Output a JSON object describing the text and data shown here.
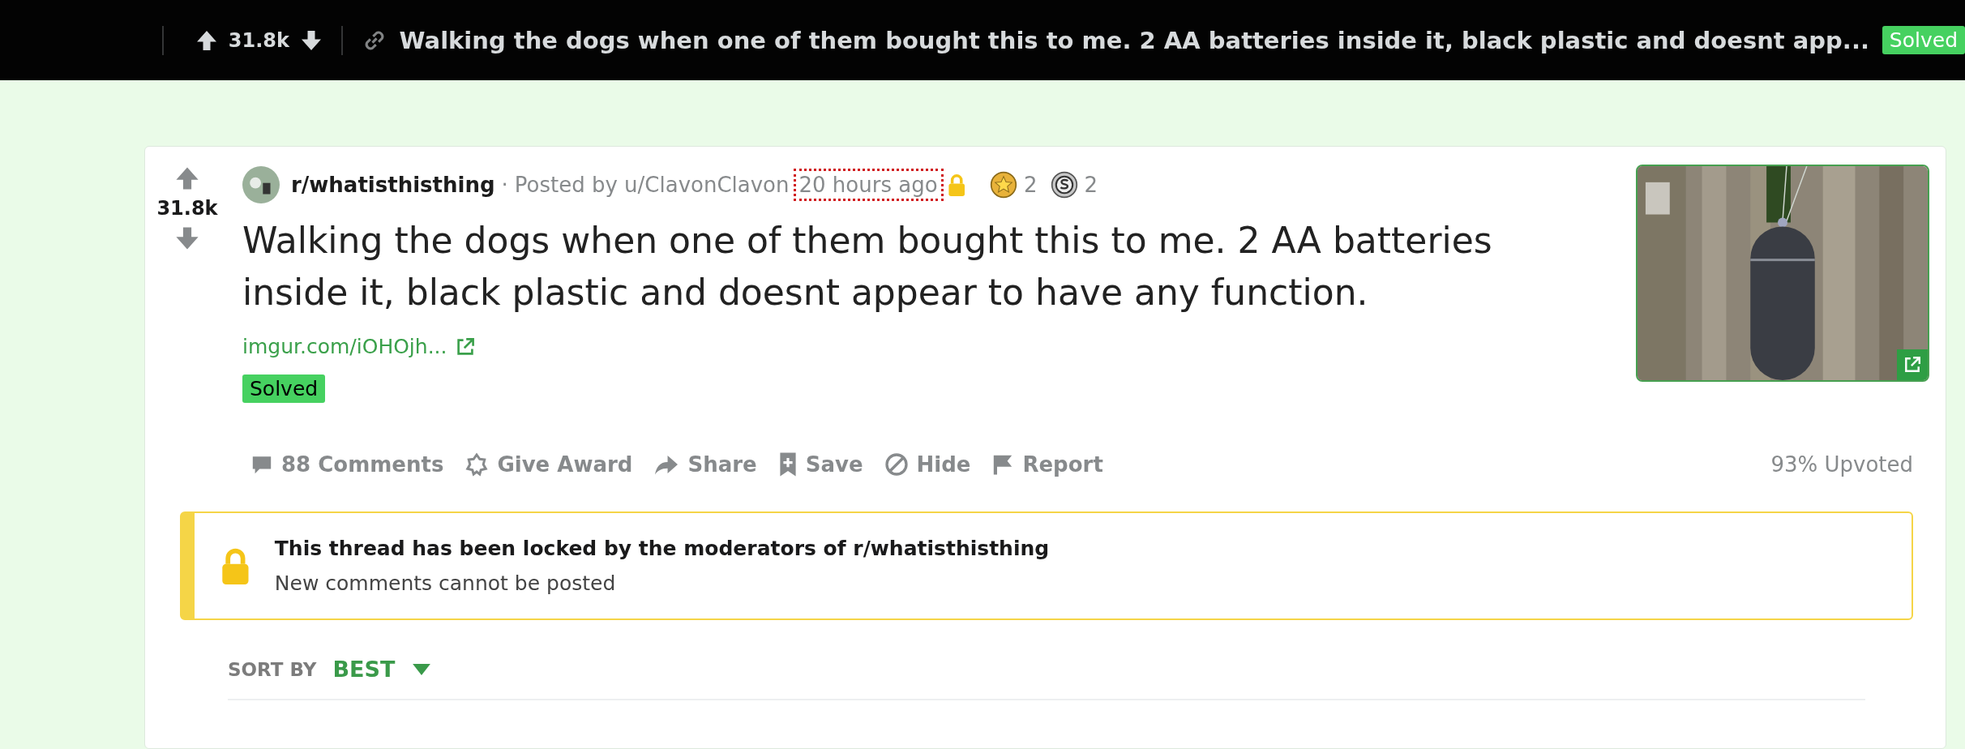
{
  "top_bar": {
    "score": "31.8k",
    "title": "Walking the dogs when one of them bought this to me. 2 AA batteries inside it, black plastic and doesnt app...",
    "flair": "Solved"
  },
  "post": {
    "score": "31.8k",
    "subreddit": "r/whatisthisthing",
    "separator": "·",
    "posted_by": "Posted by u/ClavonClavon",
    "time": {
      "text": "20 hours ago",
      "focused": true
    },
    "locked": true,
    "awards": [
      {
        "kind": "gold",
        "count": "2"
      },
      {
        "kind": "silver",
        "count": "2"
      }
    ],
    "title": "Walking the dogs when one of them bought this to me. 2 AA batteries inside it, black plastic and doesnt appear to have any function.",
    "link": "imgur.com/iOHOjh...",
    "flair": "Solved",
    "actions": [
      {
        "kind": "comments",
        "label": "88 Comments"
      },
      {
        "kind": "award",
        "label": "Give Award"
      },
      {
        "kind": "share",
        "label": "Share"
      },
      {
        "kind": "save",
        "label": "Save"
      },
      {
        "kind": "hide",
        "label": "Hide"
      },
      {
        "kind": "report",
        "label": "Report"
      }
    ],
    "upvoted": "93% Upvoted"
  },
  "lock_banner": {
    "title": "This thread has been locked by the moderators of r/whatisthisthing",
    "subtitle": "New comments cannot be posted"
  },
  "sort": {
    "label": "SORT BY",
    "value": "BEST"
  }
}
